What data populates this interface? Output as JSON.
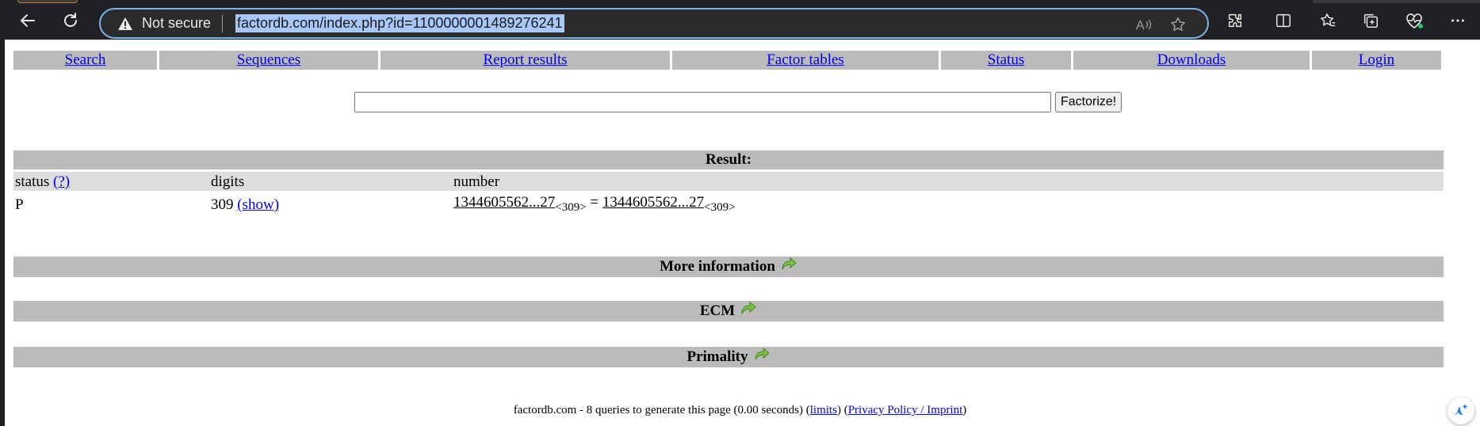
{
  "browser": {
    "security_label": "Not secure",
    "url": "factordb.com/index.php?id=1100000001489276241"
  },
  "menu": [
    {
      "label": "Search"
    },
    {
      "label": "Sequences"
    },
    {
      "label": "Report results"
    },
    {
      "label": "Factor tables"
    },
    {
      "label": "Status"
    },
    {
      "label": "Downloads"
    },
    {
      "label": "Login"
    }
  ],
  "search": {
    "value": "",
    "button_label": "Factorize!"
  },
  "result": {
    "title": "Result:",
    "headers": {
      "status": "status",
      "status_help": "(?)",
      "digits": "digits",
      "number": "number"
    },
    "row": {
      "status": "P",
      "digits": "309",
      "show_label": "(show)",
      "number": "1344605562...27",
      "number_digits": "<309>",
      "equals": "=",
      "factor": "1344605562...27",
      "factor_digits": "<309>"
    }
  },
  "sections": {
    "more_info": "More information",
    "ecm": "ECM",
    "primality": "Primality"
  },
  "footer": {
    "text": "factordb.com - 8 queries to generate this page (0.00 seconds)",
    "open1": " (",
    "limits": "limits",
    "mid": ") (",
    "privacy": "Privacy Policy / Imprint",
    "close": ")"
  },
  "colors": {
    "bar": "#bbbbbb",
    "header_row": "#dddddd",
    "link": "#0000ee",
    "arrow": "#7cc242"
  },
  "icons": [
    "back-arrow-icon",
    "reload-icon",
    "warning-icon",
    "read-aloud-icon",
    "favorite-star-icon",
    "extensions-icon",
    "split-screen-icon",
    "favorites-icon",
    "collections-icon",
    "browser-health-icon",
    "more-icon",
    "expand-arrow-icon",
    "copilot-sparkle-icon"
  ]
}
